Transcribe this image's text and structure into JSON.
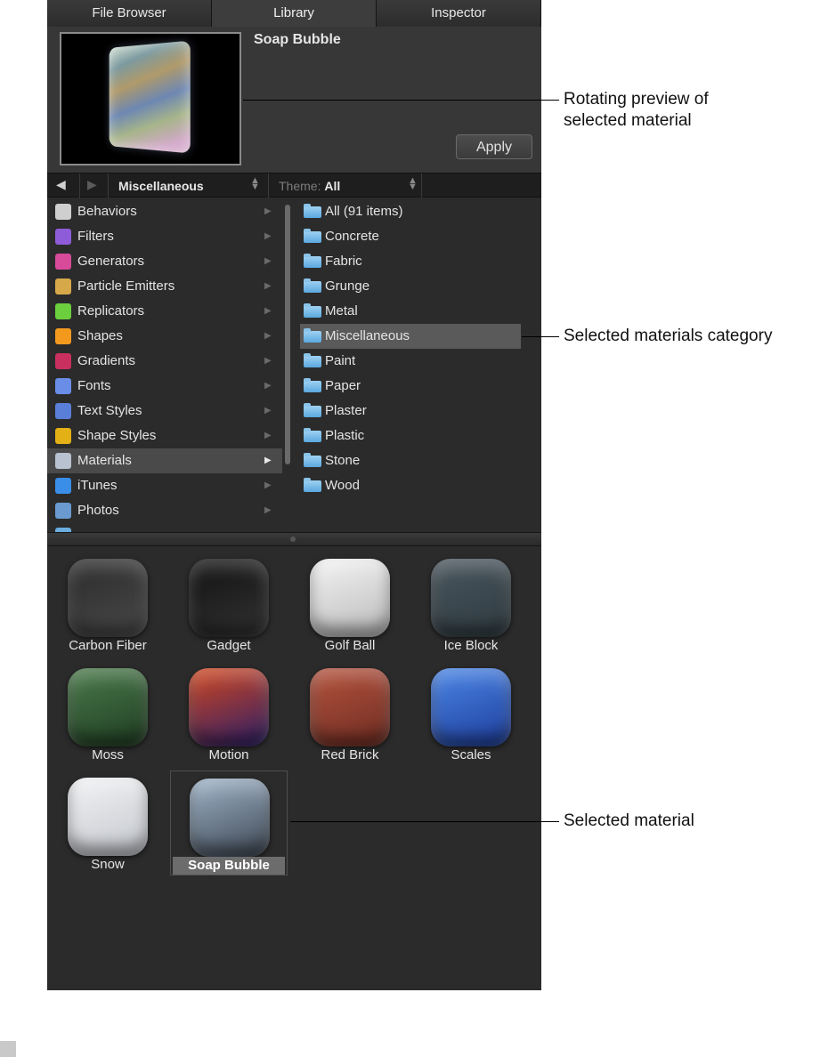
{
  "tabs": [
    {
      "label": "File Browser"
    },
    {
      "label": "Library"
    },
    {
      "label": "Inspector"
    }
  ],
  "preview": {
    "title": "Soap Bubble",
    "apply_label": "Apply"
  },
  "nav": {
    "back_icon": "◀",
    "forward_icon": "▶",
    "folder": "Miscellaneous",
    "theme_label": "Theme:",
    "theme_value": "All"
  },
  "categories": [
    {
      "label": "Behaviors",
      "icon": "gear-icon",
      "color": "#cfcfcf"
    },
    {
      "label": "Filters",
      "icon": "filter-icon",
      "color": "#8e5cd8"
    },
    {
      "label": "Generators",
      "icon": "generator-icon",
      "color": "#d84a9a"
    },
    {
      "label": "Particle Emitters",
      "icon": "particle-icon",
      "color": "#d7a84a"
    },
    {
      "label": "Replicators",
      "icon": "replicator-icon",
      "color": "#6ccf3e"
    },
    {
      "label": "Shapes",
      "icon": "shapes-icon",
      "color": "#f39a1e"
    },
    {
      "label": "Gradients",
      "icon": "gradient-icon",
      "color": "#c9305f"
    },
    {
      "label": "Fonts",
      "icon": "font-icon",
      "color": "#6a8ee8"
    },
    {
      "label": "Text Styles",
      "icon": "text-style-icon",
      "color": "#5a7fd8"
    },
    {
      "label": "Shape Styles",
      "icon": "shape-style-icon",
      "color": "#e3b016"
    },
    {
      "label": "Materials",
      "icon": "material-icon",
      "color": "#b8c2d0"
    },
    {
      "label": "iTunes",
      "icon": "music-icon",
      "color": "#3a8ee8"
    },
    {
      "label": "Photos",
      "icon": "photo-icon",
      "color": "#6a9ad0"
    },
    {
      "label": "",
      "icon": "folder-icon",
      "color": "#6aaee0"
    }
  ],
  "subcategories": [
    {
      "label": "All (91 items)"
    },
    {
      "label": "Concrete"
    },
    {
      "label": "Fabric"
    },
    {
      "label": "Grunge"
    },
    {
      "label": "Metal"
    },
    {
      "label": "Miscellaneous"
    },
    {
      "label": "Paint"
    },
    {
      "label": "Paper"
    },
    {
      "label": "Plaster"
    },
    {
      "label": "Plastic"
    },
    {
      "label": "Stone"
    },
    {
      "label": "Wood"
    }
  ],
  "materials": [
    {
      "label": "Carbon Fiber",
      "colors": [
        "#2a2a2a",
        "#4a4a4a"
      ]
    },
    {
      "label": "Gadget",
      "colors": [
        "#111111",
        "#333333"
      ]
    },
    {
      "label": "Golf Ball",
      "colors": [
        "#f4f4f4",
        "#b9b9b9"
      ]
    },
    {
      "label": "Ice Block",
      "colors": [
        "#4a565e",
        "#2e3a40"
      ]
    },
    {
      "label": "Moss",
      "colors": [
        "#4a7a4a",
        "#1f3d22"
      ]
    },
    {
      "label": "Motion",
      "colors": [
        "#d2461e",
        "#2b1f6a"
      ]
    },
    {
      "label": "Red Brick",
      "colors": [
        "#b5533e",
        "#6e2c22"
      ]
    },
    {
      "label": "Scales",
      "colors": [
        "#4a86e6",
        "#1e3d9c"
      ]
    },
    {
      "label": "Snow",
      "colors": [
        "#f2f3f5",
        "#c3c6cc"
      ]
    },
    {
      "label": "Soap Bubble",
      "colors": [
        "#9fb4c9",
        "#3d4652"
      ]
    }
  ],
  "callouts": {
    "preview": "Rotating preview of selected material",
    "category": "Selected materials category",
    "material": "Selected material"
  }
}
